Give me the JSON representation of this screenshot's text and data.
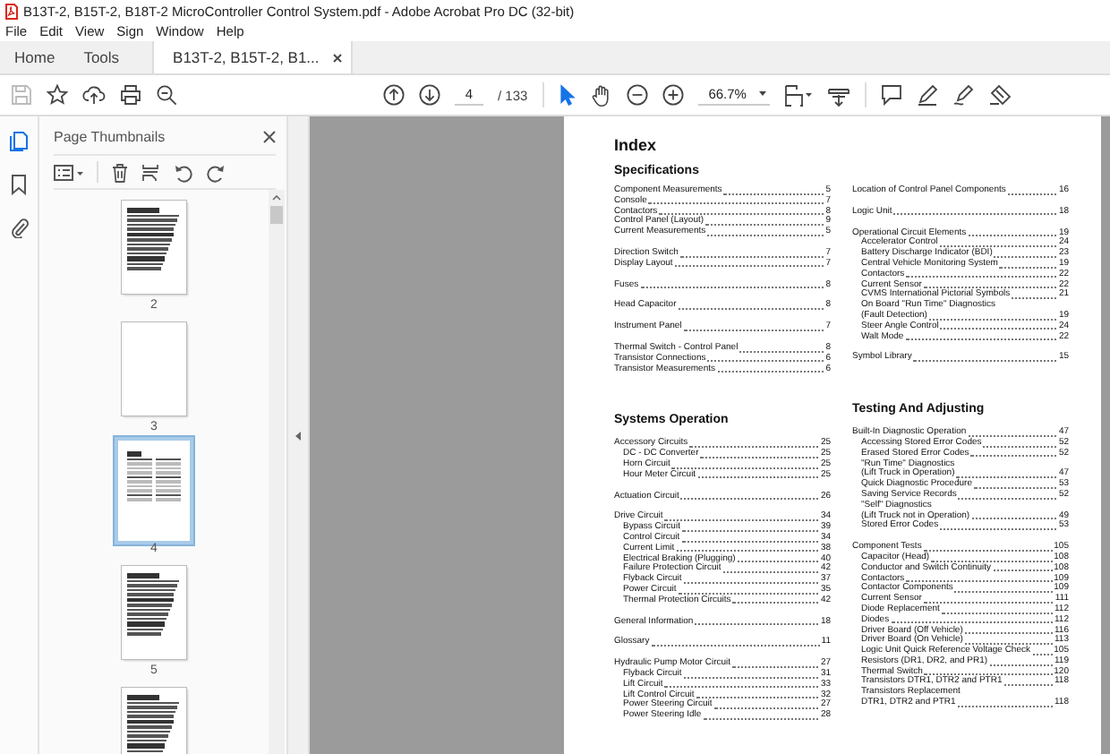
{
  "window": {
    "title": "B13T-2, B15T-2, B18T-2 MicroController Control System.pdf - Adobe Acrobat Pro DC (32-bit)"
  },
  "menu": [
    "File",
    "Edit",
    "View",
    "Sign",
    "Window",
    "Help"
  ],
  "tabs": [
    {
      "label": "Home",
      "selected": false,
      "kind": "nav"
    },
    {
      "label": "Tools",
      "selected": false,
      "kind": "nav"
    },
    {
      "label": "B13T-2, B15T-2, B1...",
      "selected": true,
      "kind": "document"
    }
  ],
  "toolbar": {
    "save": {
      "disabled": true
    },
    "page_field": {
      "value": "4"
    },
    "page_total": "/ 133",
    "tools": [
      {
        "kind": "select",
        "selected": true
      },
      {
        "kind": "hand",
        "selected": false
      }
    ],
    "zoom": {
      "value": "66.7%"
    }
  },
  "navigation_pane": {
    "rail": [
      {
        "kind": "pages",
        "selected": true
      },
      {
        "kind": "bookmarks",
        "selected": false
      },
      {
        "kind": "attachments",
        "selected": false
      }
    ],
    "title": "Page Thumbnails",
    "thumbnails": [
      {
        "label": "2",
        "kind": "text",
        "selected": false
      },
      {
        "label": "3",
        "kind": "blank",
        "selected": false
      },
      {
        "label": "4",
        "kind": "index",
        "selected": true
      },
      {
        "label": "5",
        "kind": "text",
        "selected": false
      },
      {
        "kind": "text",
        "selected": false
      }
    ]
  },
  "document": {
    "title": "Index",
    "columns": [
      {
        "blocks": [
          {
            "heading": "Specifications"
          },
          {
            "entries": [
              {
                "label": "Component Measurements",
                "page": "5"
              },
              {
                "label": "Console",
                "page": "7"
              },
              {
                "label": "Contactors",
                "page": "8"
              },
              {
                "label": "Control Panel (Layout)",
                "page": "9"
              },
              {
                "label": "Current Measurements",
                "page": "5"
              }
            ]
          },
          {
            "entries": [
              {
                "label": "Direction Switch",
                "page": "7"
              },
              {
                "label": "Display Layout",
                "page": "7"
              }
            ]
          },
          {
            "entries": [
              {
                "label": "Fuses",
                "page": "8"
              }
            ]
          },
          {
            "entries": [
              {
                "label": "Head Capacitor",
                "page": "8"
              }
            ]
          },
          {
            "entries": [
              {
                "label": "Instrument Panel",
                "page": "7"
              }
            ]
          },
          {
            "entries": [
              {
                "label": "Thermal Switch - Control Panel",
                "page": "8"
              },
              {
                "label": "Transistor Connections",
                "page": "6"
              },
              {
                "label": "Transistor Measurements",
                "page": "6"
              }
            ]
          },
          {
            "heading": "Systems Operation"
          },
          {
            "entries": [
              {
                "label": "Accessory Circuits",
                "page": "25",
                "children": [
                  {
                    "label": "DC - DC Converter",
                    "page": "25"
                  },
                  {
                    "label": "Horn Circuit",
                    "page": "25"
                  },
                  {
                    "label": "Hour Meter Circuit",
                    "page": "25"
                  }
                ]
              }
            ]
          },
          {
            "entries": [
              {
                "label": "Actuation Circuit",
                "page": "26"
              }
            ]
          },
          {
            "entries": [
              {
                "label": "Drive Circuit",
                "page": "34",
                "children": [
                  {
                    "label": "Bypass Circuit",
                    "page": "39"
                  },
                  {
                    "label": "Control Circuit",
                    "page": "34"
                  },
                  {
                    "label": "Current Limit",
                    "page": "38"
                  },
                  {
                    "label": "Electrical Braking (Plugging)",
                    "page": "40"
                  },
                  {
                    "label": "Failure Protection Circuit",
                    "page": "42"
                  },
                  {
                    "label": "Flyback Circuit",
                    "page": "37"
                  },
                  {
                    "label": "Power Circuit",
                    "page": "35"
                  },
                  {
                    "label": "Thermal Protection Circuits",
                    "page": "42"
                  }
                ]
              }
            ]
          },
          {
            "entries": [
              {
                "label": "General Information",
                "page": "18"
              }
            ]
          },
          {
            "entries": [
              {
                "label": "Glossary",
                "page": "11"
              }
            ]
          },
          {
            "entries": [
              {
                "label": "Hydraulic Pump Motor Circuit",
                "page": "27",
                "children": [
                  {
                    "label": "Flyback Circuit",
                    "page": "31"
                  },
                  {
                    "label": "Lift Circuit",
                    "page": "33"
                  },
                  {
                    "label": "Lift Control Circuit",
                    "page": "32"
                  },
                  {
                    "label": "Power Steering Circuit",
                    "page": "27"
                  },
                  {
                    "label": "Power Steering Idle",
                    "page": "28"
                  }
                ]
              }
            ]
          }
        ]
      },
      {
        "blocks": [
          {
            "entries": [
              {
                "label": "Location of Control Panel Components",
                "page": "16"
              }
            ]
          },
          {
            "entries": [
              {
                "label": "Logic Unit",
                "page": "18"
              }
            ]
          },
          {
            "entries": [
              {
                "label": "Operational Circuit Elements",
                "page": "19",
                "children": [
                  {
                    "label": "Accelerator Control",
                    "page": "24"
                  },
                  {
                    "label": "Battery Discharge Indicator (BDI)",
                    "page": "23"
                  },
                  {
                    "label": "Central Vehicle Monitoring System",
                    "page": "19"
                  },
                  {
                    "label": "Contactors",
                    "page": "22"
                  },
                  {
                    "label": "Current Sensor",
                    "page": "22"
                  },
                  {
                    "label": "CVMS International Pictorial Symbols",
                    "page": "21"
                  },
                  {
                    "label": "On Board \"Run Time\" Diagnostics",
                    "continuation": "(Fault Detection)",
                    "page": "19"
                  },
                  {
                    "label": "Steer Angle Control",
                    "page": "24"
                  },
                  {
                    "label": "Walt Mode",
                    "page": "22"
                  }
                ]
              }
            ]
          },
          {
            "entries": [
              {
                "label": "Symbol Library",
                "page": "15"
              }
            ]
          },
          {
            "heading": "Testing And Adjusting"
          },
          {
            "entries": [
              {
                "label": "Built-In Diagnostic Operation",
                "page": "47",
                "children": [
                  {
                    "label": "Accessing Stored Error Codes",
                    "page": "52"
                  },
                  {
                    "label": "Erased Stored Error Codes",
                    "page": "52"
                  },
                  {
                    "label": "\"Run Time\" Diagnostics",
                    "continuation": "(Lift Truck in Operation)",
                    "page": "47"
                  },
                  {
                    "label": "Quick Diagnostic Procedure",
                    "page": "53"
                  },
                  {
                    "label": "Saving Service Records",
                    "page": "52"
                  },
                  {
                    "label": "\"Self\" Diagnostics",
                    "continuation": "(Lift Truck not in Operation)",
                    "page": "49"
                  },
                  {
                    "label": "Stored Error Codes",
                    "page": "53"
                  }
                ]
              }
            ]
          },
          {
            "entries": [
              {
                "label": "Component Tests",
                "page": "105",
                "children": [
                  {
                    "label": "Capacitor (Head)",
                    "page": "108"
                  },
                  {
                    "label": "Conductor and Switch Continuity",
                    "page": "108"
                  },
                  {
                    "label": "Contactors",
                    "page": "109"
                  },
                  {
                    "label": "Contactor Components",
                    "page": "109"
                  },
                  {
                    "label": "Current Sensor",
                    "page": "111"
                  },
                  {
                    "label": "Diode Replacement",
                    "page": "112"
                  },
                  {
                    "label": "Diodes",
                    "page": "112"
                  },
                  {
                    "label": "Driver Board (Off Vehicle)",
                    "page": "116"
                  },
                  {
                    "label": "Driver Board (On Vehicle)",
                    "page": "113"
                  },
                  {
                    "label": "Logic Unit Quick Reference Voltage Check",
                    "page": "105"
                  },
                  {
                    "label": "Resistors (DR1, DR2, and PR1)",
                    "page": "119"
                  },
                  {
                    "label": "Thermal Switch",
                    "page": "120"
                  },
                  {
                    "label": "Transistors DTR1, DTR2 and PTR1",
                    "page": "118"
                  },
                  {
                    "label": "Transistors Replacement",
                    "continuation": "DTR1, DTR2 and PTR1",
                    "page": "118"
                  }
                ]
              }
            ]
          }
        ]
      }
    ]
  }
}
